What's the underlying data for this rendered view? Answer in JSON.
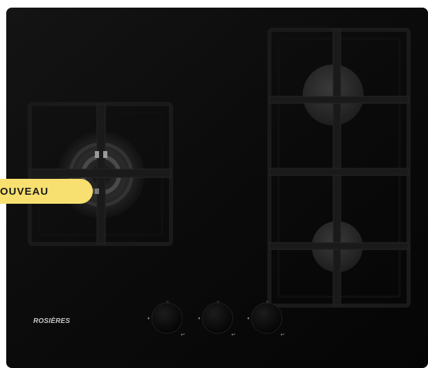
{
  "product": {
    "brand": "ROSIÈRES"
  },
  "badge": {
    "label": "OUVEAU",
    "background_color": "#f7e06f"
  },
  "colors": {
    "cooktop_surface": "#0b0b0b",
    "pan_support": "#141414",
    "burner_cap": "#2b2b2b",
    "knob": "#090909"
  },
  "controls": {
    "knob_count": 3
  }
}
